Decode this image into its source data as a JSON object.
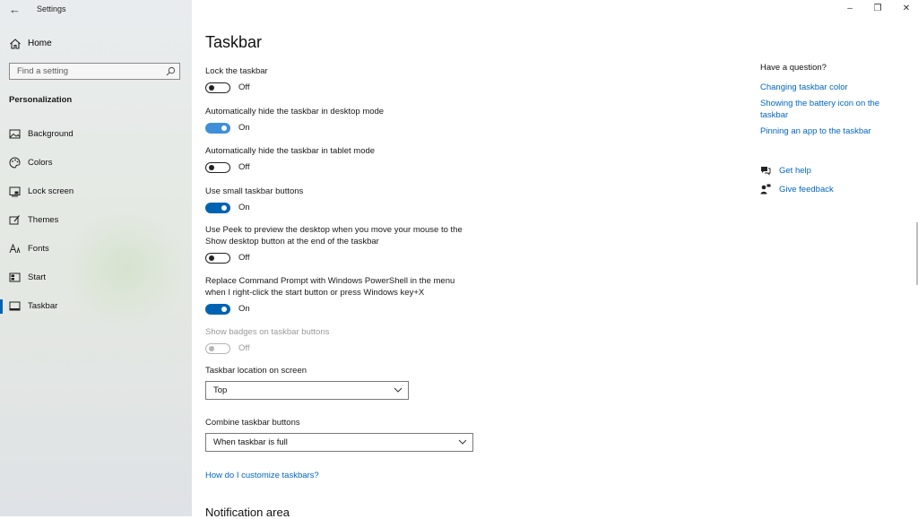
{
  "window": {
    "title": "Settings"
  },
  "sidebar": {
    "home_label": "Home",
    "search_placeholder": "Find a setting",
    "section_title": "Personalization",
    "items": [
      {
        "label": "Background",
        "icon": "picture-icon"
      },
      {
        "label": "Colors",
        "icon": "palette-icon"
      },
      {
        "label": "Lock screen",
        "icon": "lock-screen-icon"
      },
      {
        "label": "Themes",
        "icon": "themes-icon"
      },
      {
        "label": "Fonts",
        "icon": "fonts-icon"
      },
      {
        "label": "Start",
        "icon": "start-icon"
      },
      {
        "label": "Taskbar",
        "icon": "taskbar-icon",
        "active": true
      }
    ]
  },
  "page": {
    "title": "Taskbar",
    "settings": [
      {
        "label": "Lock the taskbar",
        "state": "Off",
        "on": false
      },
      {
        "label": "Automatically hide the taskbar in desktop mode",
        "state": "On",
        "on": true
      },
      {
        "label": "Automatically hide the taskbar in tablet mode",
        "state": "Off",
        "on": false
      },
      {
        "label": "Use small taskbar buttons",
        "state": "On",
        "on": true
      },
      {
        "label": "Use Peek to preview the desktop when you move your mouse to the Show desktop button at the end of the taskbar",
        "state": "Off",
        "on": false
      },
      {
        "label": "Replace Command Prompt with Windows PowerShell in the menu when I right-click the start button or press Windows key+X",
        "state": "On",
        "on": true
      },
      {
        "label": "Show badges on taskbar buttons",
        "state": "Off",
        "on": false,
        "disabled": true
      }
    ],
    "location": {
      "label": "Taskbar location on screen",
      "value": "Top"
    },
    "combine": {
      "label": "Combine taskbar buttons",
      "value": "When taskbar is full"
    },
    "help_link": "How do I customize taskbars?",
    "next_section": "Notification area"
  },
  "aside": {
    "question": "Have a question?",
    "links": [
      "Changing taskbar color",
      "Showing the battery icon on the taskbar",
      "Pinning an app to the taskbar"
    ],
    "get_help": "Get help",
    "give_feedback": "Give feedback"
  },
  "colors": {
    "accent": "#0063b1",
    "accent_hover": "#3f8fd8",
    "link": "#0067c0"
  }
}
